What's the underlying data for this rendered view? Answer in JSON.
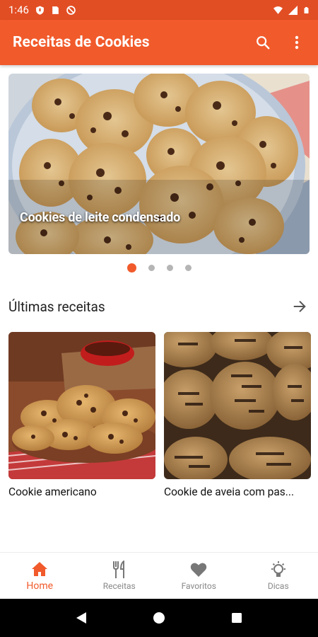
{
  "status_bar": {
    "time": "1:46",
    "icons": [
      "shield-icon",
      "sim-card-icon",
      "no-disturb-icon",
      "wifi-icon",
      "signal-icon",
      "battery-icon"
    ]
  },
  "app_bar": {
    "title": "Receitas de Cookies",
    "actions": [
      "search-icon",
      "more-vert-icon"
    ],
    "color": "#f15a2b"
  },
  "carousel": {
    "caption": "Cookies de leite condensado",
    "page_count": 4,
    "active_index": 0
  },
  "latest": {
    "title": "Últimas receitas",
    "recipes": [
      {
        "name": "Cookie americano"
      },
      {
        "name": "Cookie de aveia com pas..."
      }
    ]
  },
  "bottom_nav": {
    "items": [
      {
        "label": "Home",
        "icon": "home-icon",
        "active": true
      },
      {
        "label": "Receitas",
        "icon": "cutlery-icon",
        "active": false
      },
      {
        "label": "Favoritos",
        "icon": "heart-icon",
        "active": false
      },
      {
        "label": "Dicas",
        "icon": "lightbulb-icon",
        "active": false
      }
    ],
    "accent": "#f15a2b"
  },
  "system_nav": [
    "back-icon",
    "home-circle-icon",
    "recents-icon"
  ]
}
